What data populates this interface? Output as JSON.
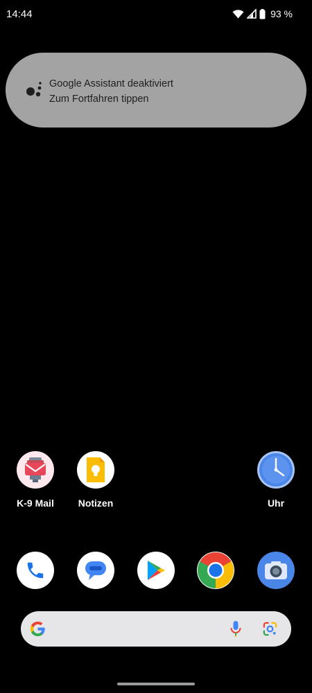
{
  "status_bar": {
    "time": "14:44",
    "battery": "93 %",
    "icons": [
      "wifi-icon",
      "cellular-signal-icon",
      "battery-icon"
    ]
  },
  "assistant_banner": {
    "title": "Google Assistant deaktiviert",
    "subtitle": "Zum Fortfahren tippen",
    "icon": "google-assistant-icon",
    "background": "#a3a3a3"
  },
  "home_row": [
    {
      "label": "K-9 Mail",
      "icon": "k9-mail-icon"
    },
    {
      "label": "Notizen",
      "icon": "keep-notes-icon"
    },
    {
      "label": "Uhr",
      "icon": "clock-icon"
    }
  ],
  "dock": [
    {
      "icon": "phone-icon"
    },
    {
      "icon": "messages-icon"
    },
    {
      "icon": "play-store-icon"
    },
    {
      "icon": "chrome-icon"
    },
    {
      "icon": "camera-icon"
    }
  ],
  "search_bar": {
    "icons": [
      "google-g-icon",
      "microphone-icon",
      "google-lens-icon"
    ]
  },
  "colors": {
    "background": "#000000",
    "google_blue": "#4285F4",
    "google_red": "#EA4335",
    "google_yellow": "#FBBC05",
    "google_green": "#34A853"
  }
}
